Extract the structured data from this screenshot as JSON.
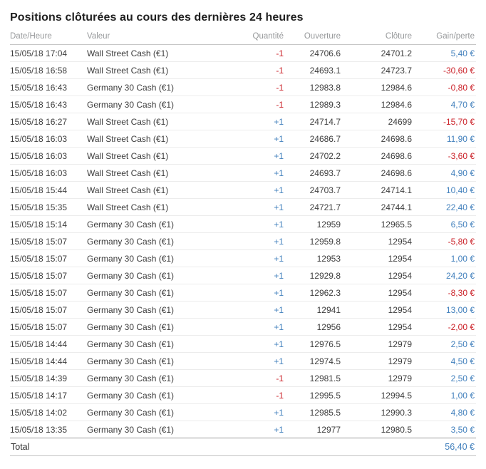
{
  "title": "Positions clôturées au cours des dernières 24 heures",
  "colors": {
    "profit_blue": "#4381bd",
    "loss_red": "#cb2229",
    "text": "#3d3d3d",
    "header_gray": "#97999b"
  },
  "table": {
    "columns": [
      "Date/Heure",
      "Valeur",
      "Quantité",
      "Ouverture",
      "Clôture",
      "Gain/perte"
    ],
    "rows": [
      {
        "datetime": "15/05/18 17:04",
        "value": "Wall Street Cash (€1)",
        "qty": "-1",
        "open": "24706.6",
        "close": "24701.2",
        "gain": "5,40 €"
      },
      {
        "datetime": "15/05/18 16:58",
        "value": "Wall Street Cash (€1)",
        "qty": "-1",
        "open": "24693.1",
        "close": "24723.7",
        "gain": "-30,60 €"
      },
      {
        "datetime": "15/05/18 16:43",
        "value": "Germany 30 Cash (€1)",
        "qty": "-1",
        "open": "12983.8",
        "close": "12984.6",
        "gain": "-0,80 €"
      },
      {
        "datetime": "15/05/18 16:43",
        "value": "Germany 30 Cash (€1)",
        "qty": "-1",
        "open": "12989.3",
        "close": "12984.6",
        "gain": "4,70 €"
      },
      {
        "datetime": "15/05/18 16:27",
        "value": "Wall Street Cash (€1)",
        "qty": "+1",
        "open": "24714.7",
        "close": "24699",
        "gain": "-15,70 €"
      },
      {
        "datetime": "15/05/18 16:03",
        "value": "Wall Street Cash (€1)",
        "qty": "+1",
        "open": "24686.7",
        "close": "24698.6",
        "gain": "11,90 €"
      },
      {
        "datetime": "15/05/18 16:03",
        "value": "Wall Street Cash (€1)",
        "qty": "+1",
        "open": "24702.2",
        "close": "24698.6",
        "gain": "-3,60 €"
      },
      {
        "datetime": "15/05/18 16:03",
        "value": "Wall Street Cash (€1)",
        "qty": "+1",
        "open": "24693.7",
        "close": "24698.6",
        "gain": "4,90 €"
      },
      {
        "datetime": "15/05/18 15:44",
        "value": "Wall Street Cash (€1)",
        "qty": "+1",
        "open": "24703.7",
        "close": "24714.1",
        "gain": "10,40 €"
      },
      {
        "datetime": "15/05/18 15:35",
        "value": "Wall Street Cash (€1)",
        "qty": "+1",
        "open": "24721.7",
        "close": "24744.1",
        "gain": "22,40 €"
      },
      {
        "datetime": "15/05/18 15:14",
        "value": "Germany 30 Cash (€1)",
        "qty": "+1",
        "open": "12959",
        "close": "12965.5",
        "gain": "6,50 €"
      },
      {
        "datetime": "15/05/18 15:07",
        "value": "Germany 30 Cash (€1)",
        "qty": "+1",
        "open": "12959.8",
        "close": "12954",
        "gain": "-5,80 €"
      },
      {
        "datetime": "15/05/18 15:07",
        "value": "Germany 30 Cash (€1)",
        "qty": "+1",
        "open": "12953",
        "close": "12954",
        "gain": "1,00 €"
      },
      {
        "datetime": "15/05/18 15:07",
        "value": "Germany 30 Cash (€1)",
        "qty": "+1",
        "open": "12929.8",
        "close": "12954",
        "gain": "24,20 €"
      },
      {
        "datetime": "15/05/18 15:07",
        "value": "Germany 30 Cash (€1)",
        "qty": "+1",
        "open": "12962.3",
        "close": "12954",
        "gain": "-8,30 €"
      },
      {
        "datetime": "15/05/18 15:07",
        "value": "Germany 30 Cash (€1)",
        "qty": "+1",
        "open": "12941",
        "close": "12954",
        "gain": "13,00 €"
      },
      {
        "datetime": "15/05/18 15:07",
        "value": "Germany 30 Cash (€1)",
        "qty": "+1",
        "open": "12956",
        "close": "12954",
        "gain": "-2,00 €"
      },
      {
        "datetime": "15/05/18 14:44",
        "value": "Germany 30 Cash (€1)",
        "qty": "+1",
        "open": "12976.5",
        "close": "12979",
        "gain": "2,50 €"
      },
      {
        "datetime": "15/05/18 14:44",
        "value": "Germany 30 Cash (€1)",
        "qty": "+1",
        "open": "12974.5",
        "close": "12979",
        "gain": "4,50 €"
      },
      {
        "datetime": "15/05/18 14:39",
        "value": "Germany 30 Cash (€1)",
        "qty": "-1",
        "open": "12981.5",
        "close": "12979",
        "gain": "2,50 €"
      },
      {
        "datetime": "15/05/18 14:17",
        "value": "Germany 30 Cash (€1)",
        "qty": "-1",
        "open": "12995.5",
        "close": "12994.5",
        "gain": "1,00 €"
      },
      {
        "datetime": "15/05/18 14:02",
        "value": "Germany 30 Cash (€1)",
        "qty": "+1",
        "open": "12985.5",
        "close": "12990.3",
        "gain": "4,80 €"
      },
      {
        "datetime": "15/05/18 13:35",
        "value": "Germany 30 Cash (€1)",
        "qty": "+1",
        "open": "12977",
        "close": "12980.5",
        "gain": "3,50 €"
      }
    ],
    "total_label": "Total",
    "total_value": "56,40 €"
  }
}
